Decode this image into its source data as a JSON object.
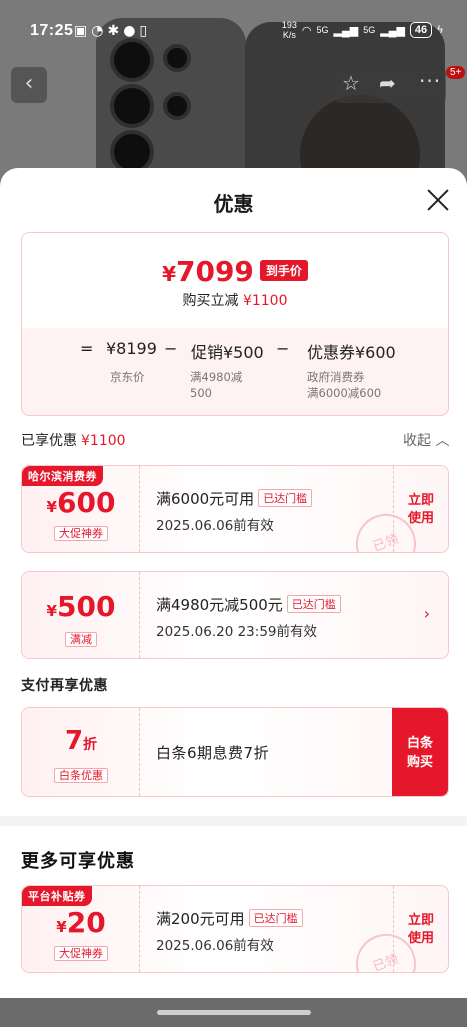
{
  "status_bar": {
    "time": "17:25",
    "net_speed_value": "193",
    "net_speed_unit": "K/s",
    "signal1": "5G",
    "signal2": "5G",
    "battery": "46"
  },
  "product_nav": {
    "cart_badge": "5+"
  },
  "sheet": {
    "title": "优惠",
    "summary": {
      "currency": "¥",
      "final_price": "7099",
      "price_tag": "到手价",
      "discount_text": "购买立减",
      "discount_amount": "¥1100",
      "eq": "=",
      "jd_price": "¥8199",
      "minus1": "−",
      "promo": "促销¥500",
      "minus2": "−",
      "coupon": "优惠券¥600",
      "jd_price_label": "京东价",
      "promo_note_1": "满4980减",
      "promo_note_2": "500",
      "coupon_note_1": "政府消费券",
      "coupon_note_2": "满6000减600"
    },
    "enjoyed_label": "已享优惠",
    "enjoyed_amount": "¥1100",
    "collapse_label": "收起",
    "coupons": [
      {
        "tag": "哈尔滨消费券",
        "currency": "¥",
        "value": "600",
        "type": "大促神券",
        "condition": "满6000元可用",
        "pill": "已达门槛",
        "validity": "2025.06.06前有效",
        "action_line1": "立即",
        "action_line2": "使用",
        "stamp": "已领"
      },
      {
        "currency": "¥",
        "value": "500",
        "type": "满减",
        "condition": "满4980元减500元",
        "pill": "已达门槛",
        "validity": "2025.06.20 23:59前有效"
      }
    ],
    "payment_label": "支付再享优惠",
    "baitiao": {
      "discount": "7",
      "unit": "折",
      "type": "白条优惠",
      "description": "白条6期息费7折",
      "btn_line1": "白条",
      "btn_line2": "购买"
    },
    "more_title": "更多可享优惠",
    "more_coupon": {
      "tag": "平台补贴券",
      "currency": "¥",
      "value": "20",
      "type": "大促神券",
      "condition": "满200元可用",
      "pill": "已达门槛",
      "validity": "2025.06.06前有效",
      "action_line1": "立即",
      "action_line2": "使用",
      "stamp": "已领"
    }
  },
  "icons": {
    "back": "chevron-left-icon",
    "favorite": "star-icon",
    "share": "share-icon",
    "more": "more-icon",
    "close": "close-icon",
    "collapse": "chevron-up-icon",
    "coupon_arrow": "chevron-right-icon"
  },
  "colors": {
    "accent_red": "#e4182a",
    "coupon_border": "#f6c9cf"
  }
}
